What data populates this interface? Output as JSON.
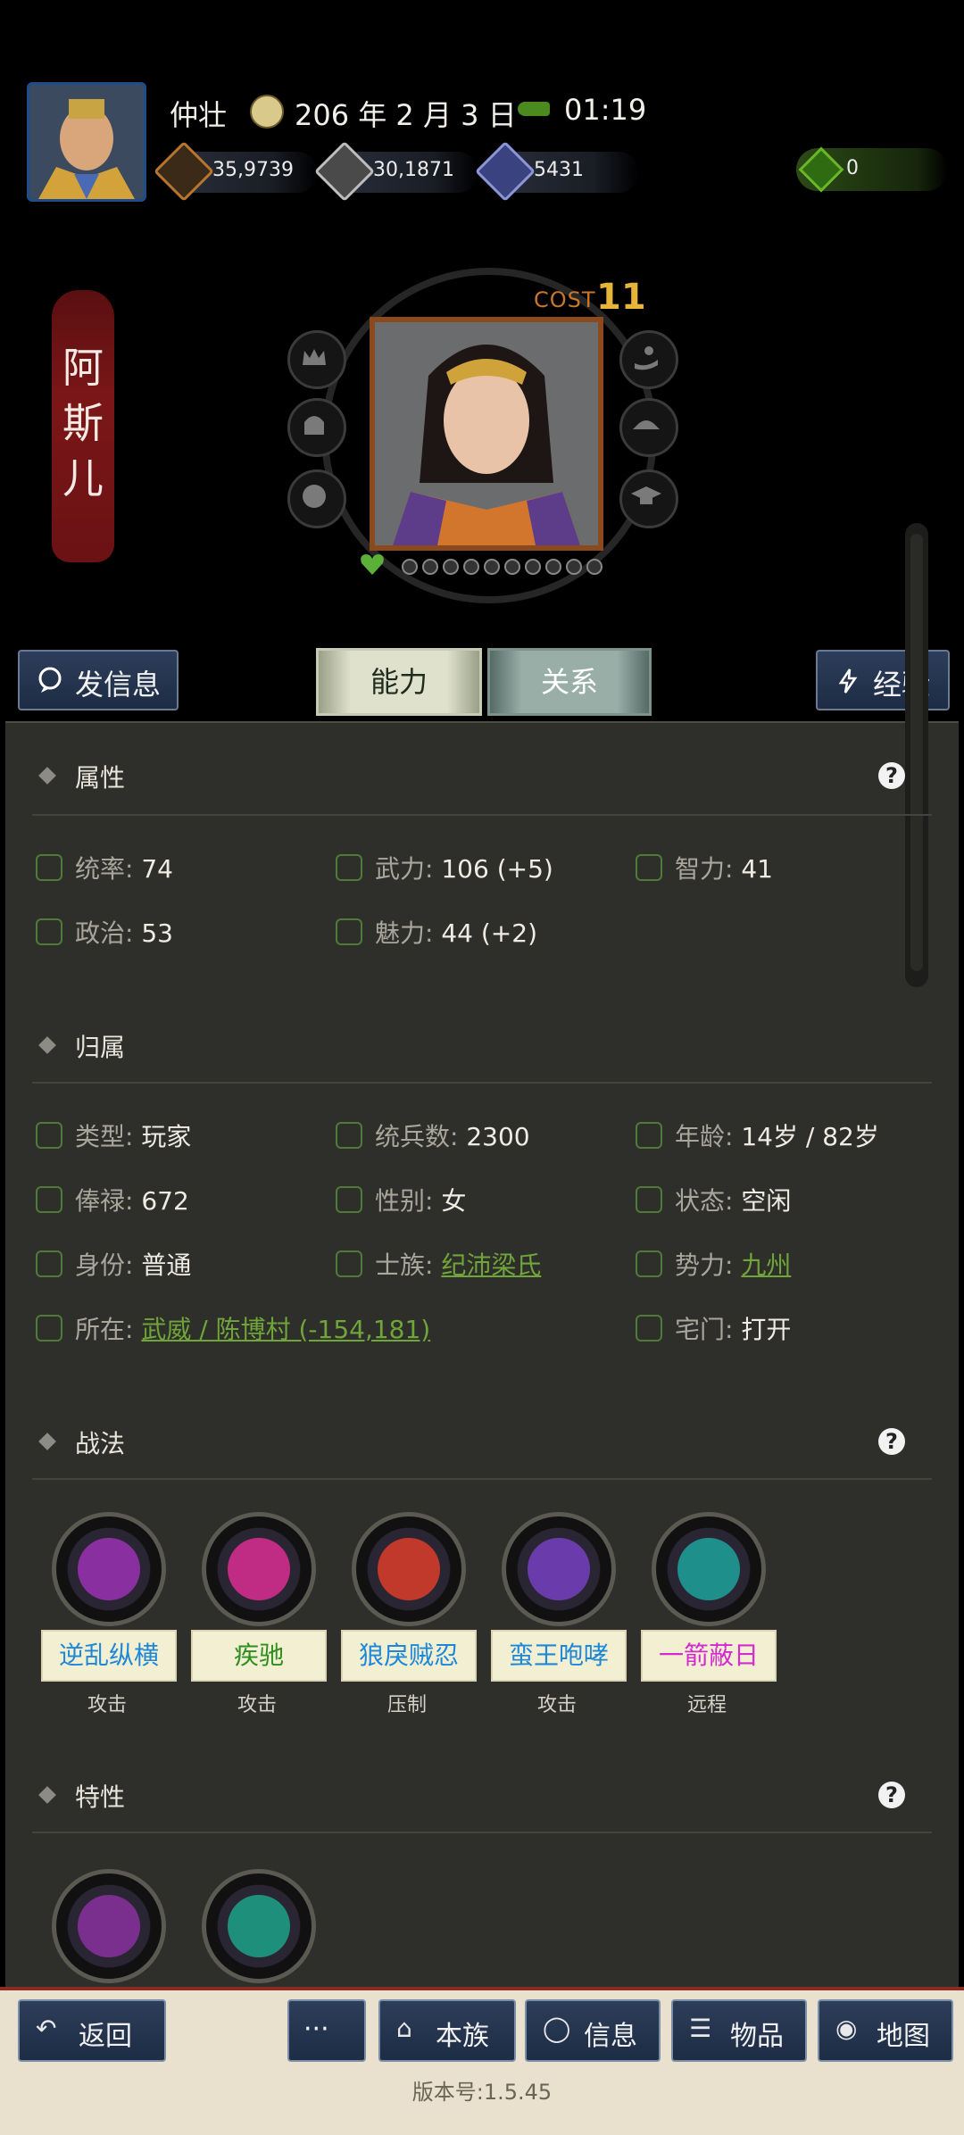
{
  "header": {
    "player_name": "仲壮",
    "date": "206 年 2 月 3 日",
    "time": "01:19",
    "resources": [
      {
        "icon": "coins-icon",
        "value": "35,9739"
      },
      {
        "icon": "grain-icon",
        "value": "30,1871"
      },
      {
        "icon": "soldier-icon",
        "value": "5431"
      }
    ],
    "gems": {
      "icon": "gem-bag-icon",
      "value": "0"
    }
  },
  "character": {
    "name_chars": [
      "阿",
      "斯",
      "儿"
    ],
    "cost_label": "COST",
    "cost_value": "11"
  },
  "actions": {
    "message": "发信息",
    "ability_tab": "能力",
    "relation_tab": "关系",
    "exp": "经验"
  },
  "attributes": {
    "title": "属性",
    "help": "?",
    "items": [
      {
        "k": "统率:",
        "v": "74"
      },
      {
        "k": "武力:",
        "v": "106 (+5)"
      },
      {
        "k": "智力:",
        "v": "41"
      },
      {
        "k": "政治:",
        "v": "53"
      },
      {
        "k": "魅力:",
        "v": "44 (+2)"
      }
    ]
  },
  "affiliation": {
    "title": "归属",
    "type_k": "类型:",
    "type_v": "玩家",
    "troops_k": "统兵数:",
    "troops_v": "2300",
    "age_k": "年龄:",
    "age_v": "14岁 / 82岁",
    "salary_k": "俸禄:",
    "salary_v": "672",
    "gender_k": "性别:",
    "gender_v": "女",
    "status_k": "状态:",
    "status_v": "空闲",
    "identity_k": "身份:",
    "identity_v": "普通",
    "clan_k": "士族:",
    "clan_v": "纪沛梁氏",
    "faction_k": "势力:",
    "faction_v": "九州",
    "location_k": "所在:",
    "location_v": "武威 / 陈博村 (-154,181)",
    "gate_k": "宅门:",
    "gate_v": "打开"
  },
  "tactics": {
    "title": "战法",
    "help": "?",
    "skills": [
      {
        "name": "逆乱纵横",
        "type": "攻击",
        "color": "#1e88d8"
      },
      {
        "name": "疾驰",
        "type": "攻击",
        "color": "#2f8f1e"
      },
      {
        "name": "狼戾贼忍",
        "type": "压制",
        "color": "#1e88d8"
      },
      {
        "name": "蛮王咆哮",
        "type": "攻击",
        "color": "#1e88d8"
      },
      {
        "name": "一箭蔽日",
        "type": "远程",
        "color": "#d42bd0"
      }
    ]
  },
  "traits": {
    "title": "特性",
    "help": "?"
  },
  "bottom_nav": {
    "back": "返回",
    "more": "···",
    "clan": "本族",
    "info": "信息",
    "items": "物品",
    "map": "地图"
  },
  "version": "版本号:1.5.45"
}
